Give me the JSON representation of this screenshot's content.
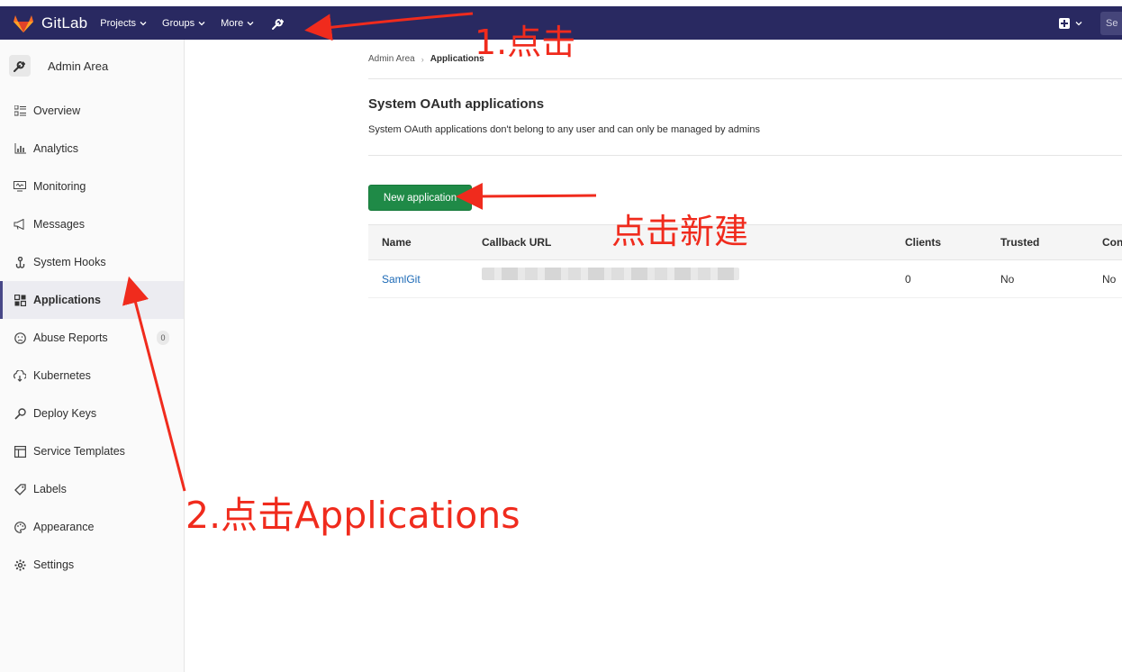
{
  "navbar": {
    "brand": "GitLab",
    "menu": [
      {
        "label": "Projects"
      },
      {
        "label": "Groups"
      },
      {
        "label": "More"
      }
    ],
    "search_stub": "Se",
    "bg_color": "#292961"
  },
  "sidebar": {
    "header_title": "Admin Area",
    "items": [
      {
        "label": "Overview",
        "icon": "overview-icon"
      },
      {
        "label": "Analytics",
        "icon": "analytics-icon"
      },
      {
        "label": "Monitoring",
        "icon": "monitoring-icon"
      },
      {
        "label": "Messages",
        "icon": "messages-icon"
      },
      {
        "label": "System Hooks",
        "icon": "hook-icon"
      },
      {
        "label": "Applications",
        "icon": "applications-icon",
        "active": true
      },
      {
        "label": "Abuse Reports",
        "icon": "abuse-icon",
        "badge": "0"
      },
      {
        "label": "Kubernetes",
        "icon": "kubernetes-icon"
      },
      {
        "label": "Deploy Keys",
        "icon": "key-icon"
      },
      {
        "label": "Service Templates",
        "icon": "template-icon"
      },
      {
        "label": "Labels",
        "icon": "label-icon"
      },
      {
        "label": "Appearance",
        "icon": "appearance-icon"
      },
      {
        "label": "Settings",
        "icon": "settings-icon"
      }
    ]
  },
  "main": {
    "breadcrumb": {
      "parent": "Admin Area",
      "current": "Applications"
    },
    "title": "System OAuth applications",
    "description": "System OAuth applications don't belong to any user and can only be managed by admins",
    "new_button": "New application",
    "table": {
      "headers": [
        "Name",
        "Callback URL",
        "Clients",
        "Trusted",
        "Con"
      ],
      "rows": [
        {
          "name": "SamlGit",
          "callback_url": "",
          "clients": "0",
          "trusted": "No",
          "confidential": "No"
        }
      ]
    }
  },
  "annotations": {
    "step1": "1.点击",
    "step_new": "点击新建",
    "step2": "2.点击Applications",
    "color": "#f02b1d"
  }
}
